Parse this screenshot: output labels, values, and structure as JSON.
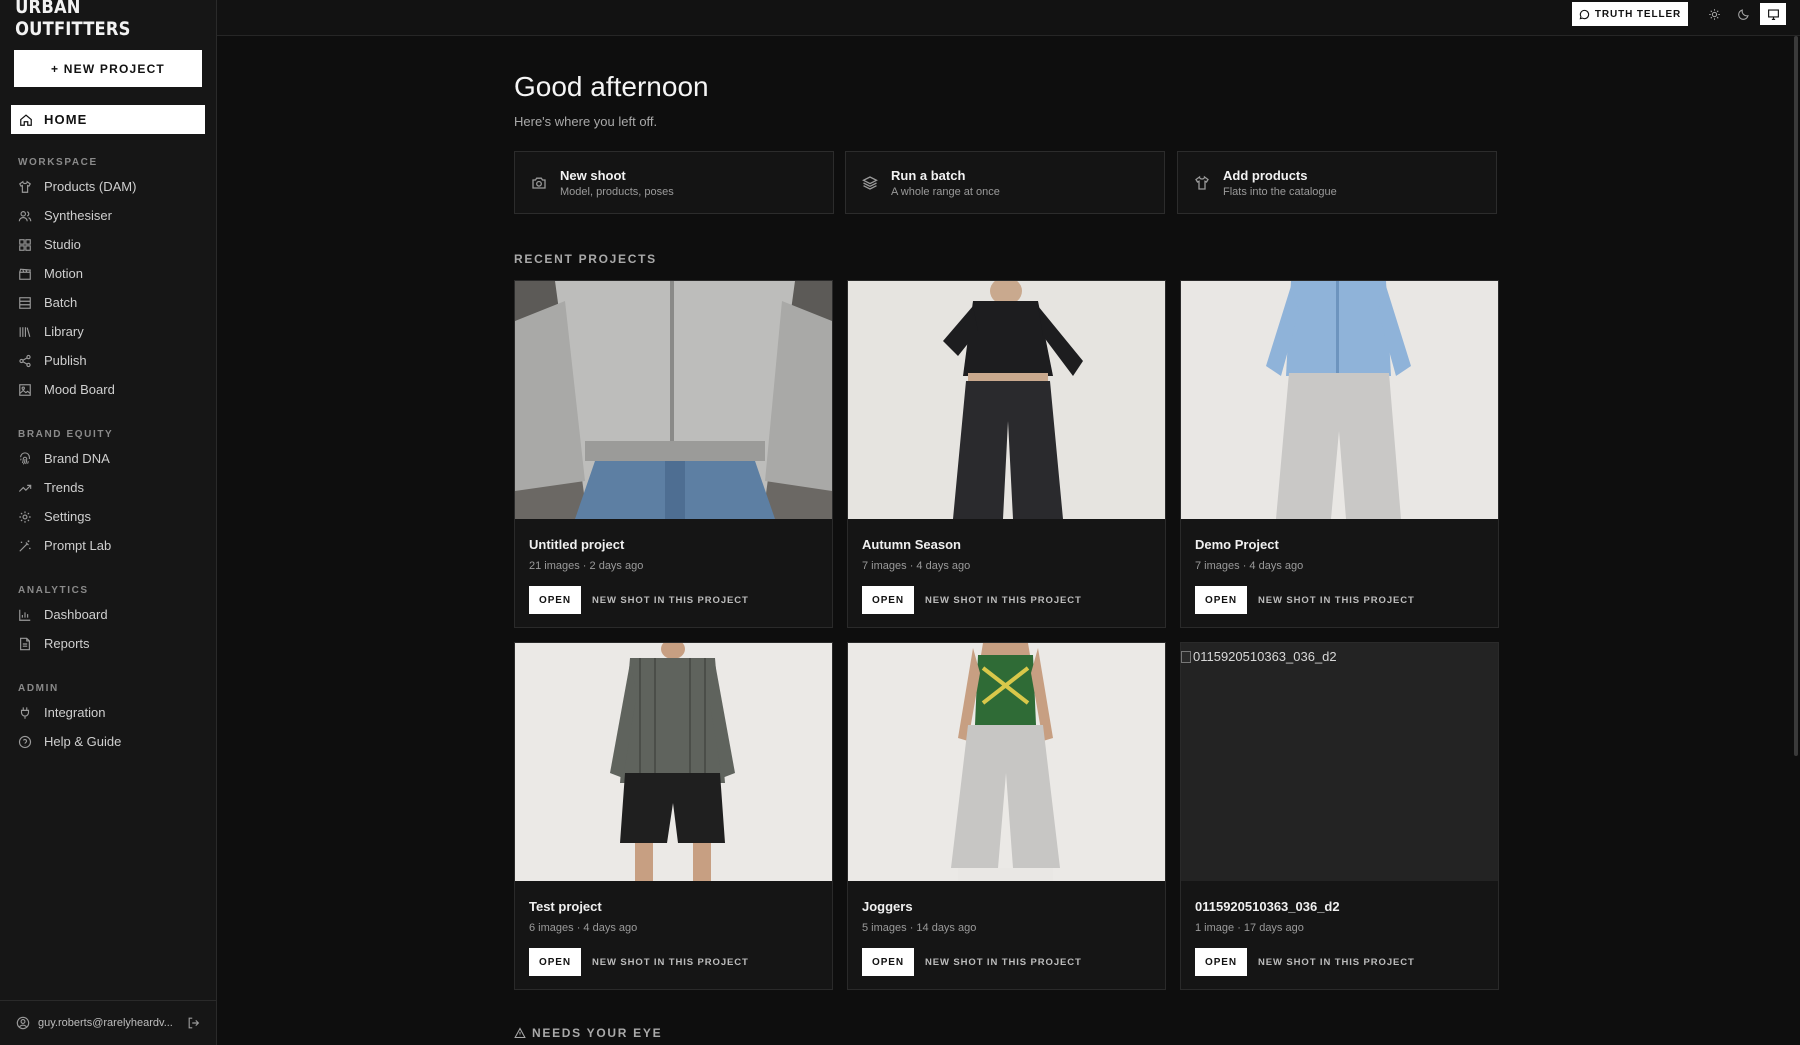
{
  "brand": "URBAN OUTFITTERS",
  "sidebar": {
    "new_project": "+ NEW PROJECT",
    "home": "HOME",
    "sections": [
      {
        "title": "WORKSPACE",
        "items": [
          {
            "label": "Products (DAM)",
            "icon": "shirt-icon"
          },
          {
            "label": "Synthesiser",
            "icon": "users-icon"
          },
          {
            "label": "Studio",
            "icon": "grid-icon"
          },
          {
            "label": "Motion",
            "icon": "clapper-icon"
          },
          {
            "label": "Batch",
            "icon": "layers-icon"
          },
          {
            "label": "Library",
            "icon": "library-icon"
          },
          {
            "label": "Publish",
            "icon": "share-icon"
          },
          {
            "label": "Mood Board",
            "icon": "image-icon"
          }
        ]
      },
      {
        "title": "BRAND EQUITY",
        "items": [
          {
            "label": "Brand DNA",
            "icon": "fingerprint-icon"
          },
          {
            "label": "Trends",
            "icon": "trending-icon"
          },
          {
            "label": "Settings",
            "icon": "gear-icon"
          },
          {
            "label": "Prompt Lab",
            "icon": "wand-icon"
          }
        ]
      },
      {
        "title": "ANALYTICS",
        "items": [
          {
            "label": "Dashboard",
            "icon": "bar-chart-icon"
          },
          {
            "label": "Reports",
            "icon": "document-icon"
          }
        ]
      },
      {
        "title": "ADMIN",
        "items": [
          {
            "label": "Integration",
            "icon": "plug-icon"
          },
          {
            "label": "Help & Guide",
            "icon": "help-icon"
          }
        ]
      }
    ],
    "user_email": "guy.roberts@rarelyheardv..."
  },
  "topbar": {
    "truth_teller": "TRUTH TELLER"
  },
  "main": {
    "greeting": "Good afternoon",
    "subtitle": "Here's where you left off.",
    "quick_actions": [
      {
        "title": "New shoot",
        "subtitle": "Model, products, poses",
        "icon": "camera-icon"
      },
      {
        "title": "Run a batch",
        "subtitle": "A whole range at once",
        "icon": "layers-icon"
      },
      {
        "title": "Add products",
        "subtitle": "Flats into the catalogue",
        "icon": "shirt-icon"
      }
    ],
    "recent_title": "RECENT PROJECTS",
    "projects": [
      {
        "title": "Untitled project",
        "meta": "21 images · 2 days ago",
        "open": "OPEN",
        "new_shot": "NEW SHOT IN THIS PROJECT"
      },
      {
        "title": "Autumn Season",
        "meta": "7 images · 4 days ago",
        "open": "OPEN",
        "new_shot": "NEW SHOT IN THIS PROJECT"
      },
      {
        "title": "Demo Project",
        "meta": "7 images · 4 days ago",
        "open": "OPEN",
        "new_shot": "NEW SHOT IN THIS PROJECT"
      },
      {
        "title": "Test project",
        "meta": "6 images · 4 days ago",
        "open": "OPEN",
        "new_shot": "NEW SHOT IN THIS PROJECT"
      },
      {
        "title": "Joggers",
        "meta": "5 images · 14 days ago",
        "open": "OPEN",
        "new_shot": "NEW SHOT IN THIS PROJECT"
      },
      {
        "title": "0115920510363_036_d2",
        "meta": "1 image · 17 days ago",
        "open": "OPEN",
        "new_shot": "NEW SHOT IN THIS PROJECT",
        "broken_image_alt": "0115920510363_036_d2"
      }
    ],
    "needs_eye": "NEEDS YOUR EYE"
  }
}
